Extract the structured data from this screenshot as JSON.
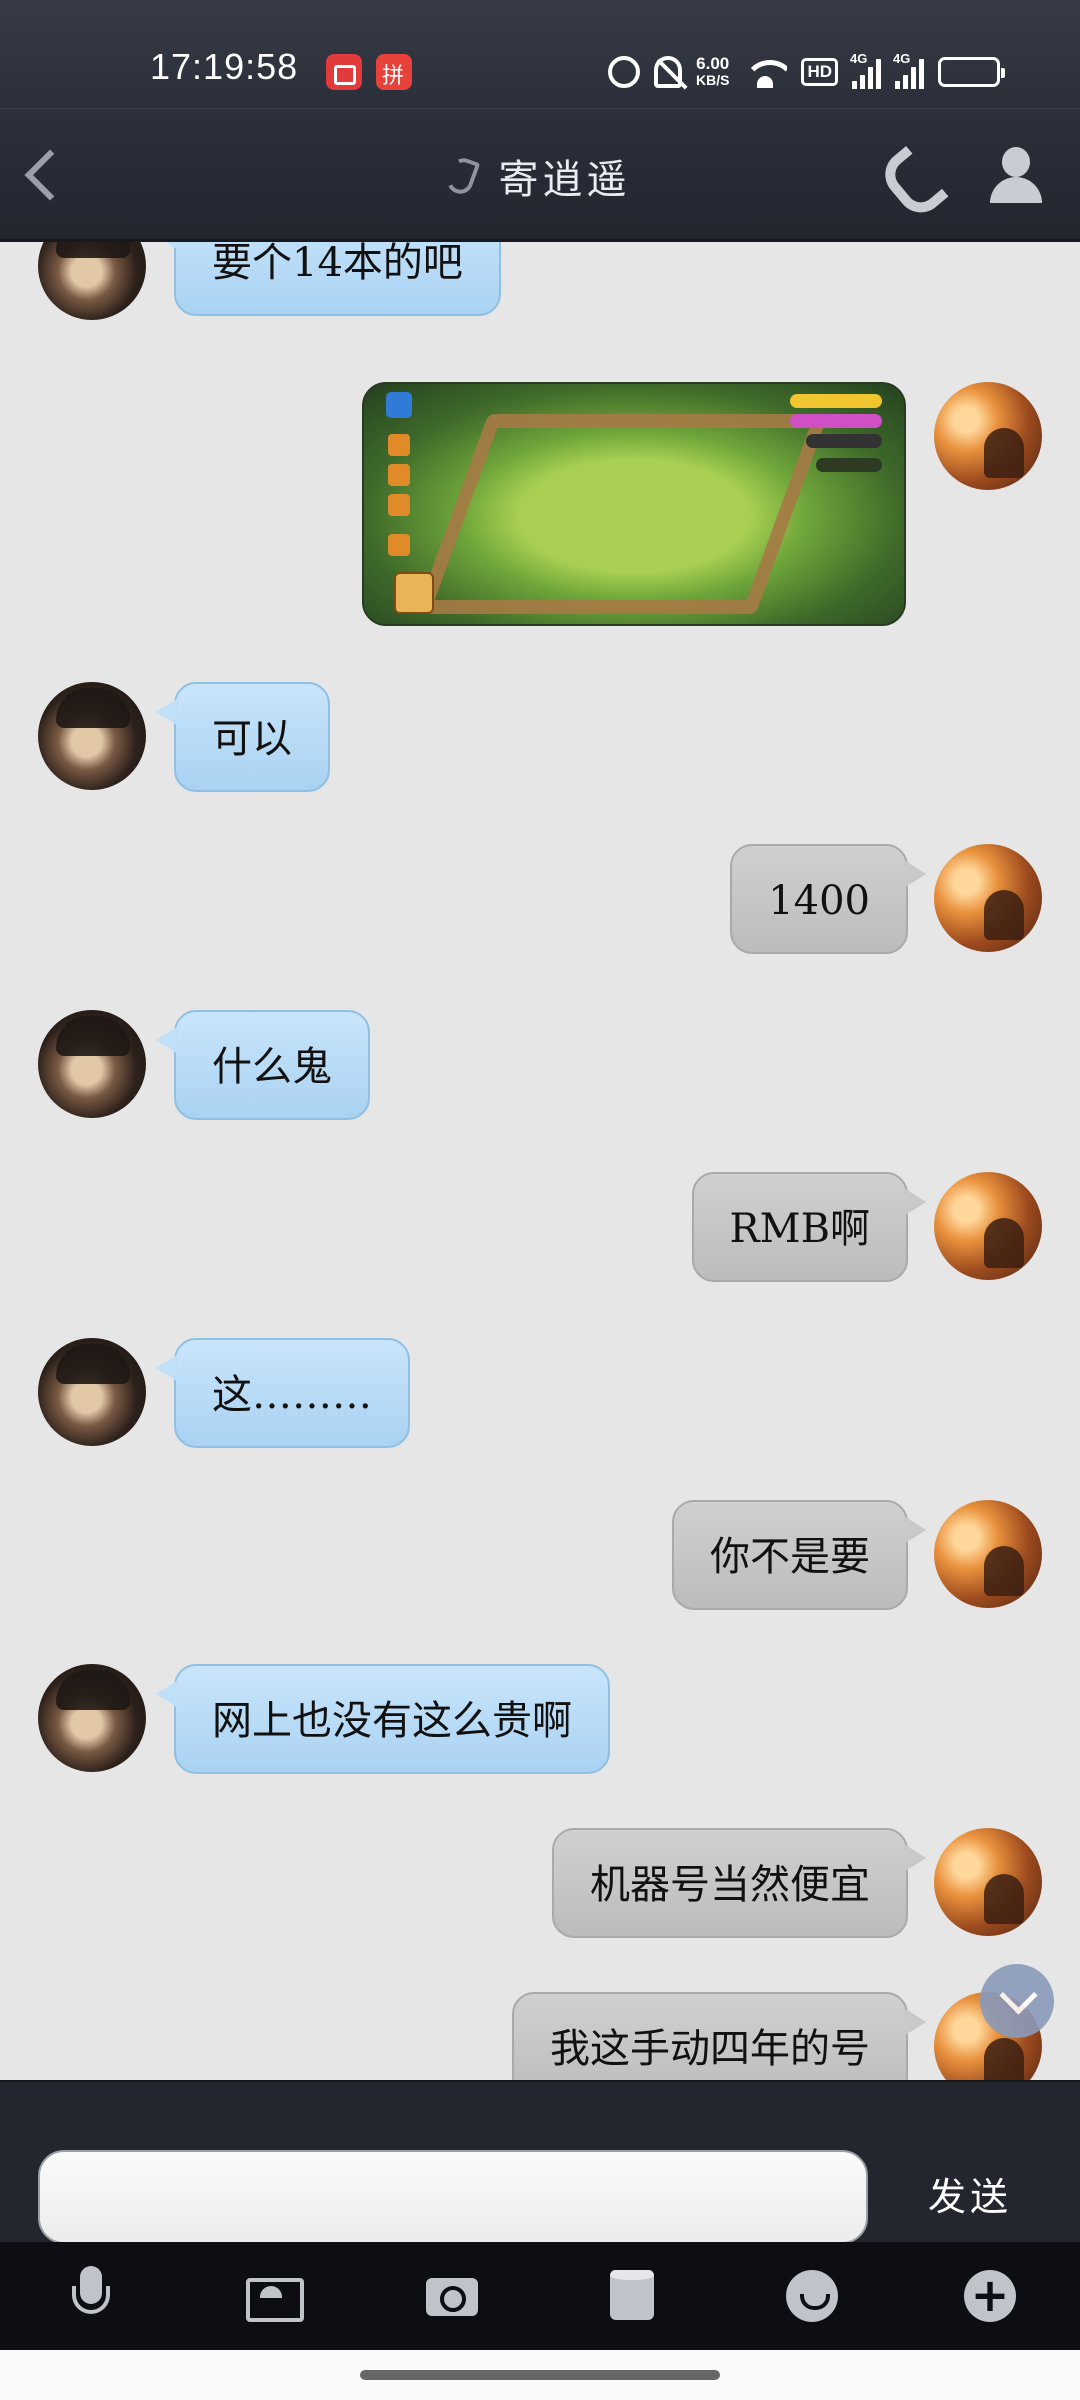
{
  "status_bar": {
    "time": "17:19:58",
    "net_speed": "6.00",
    "net_speed_unit": "KB/S",
    "hd_label": "HD",
    "sim1_label": "4G",
    "sim2_label": "4G"
  },
  "header": {
    "title": "寄逍遥"
  },
  "messages": [
    {
      "side": "in",
      "text": "要个14本的吧"
    },
    {
      "side": "out",
      "type": "image",
      "icon": "game-screenshot"
    },
    {
      "side": "in",
      "text": "可以"
    },
    {
      "side": "out",
      "text": "1400"
    },
    {
      "side": "in",
      "text": "什么鬼"
    },
    {
      "side": "out",
      "text": "RMB啊"
    },
    {
      "side": "in",
      "text": "这………"
    },
    {
      "side": "out",
      "text": "你不是要"
    },
    {
      "side": "in",
      "text": "网上也没有这么贵啊"
    },
    {
      "side": "out",
      "text": "机器号当然便宜"
    },
    {
      "side": "out",
      "text": "我这手动四年的号"
    }
  ],
  "input_bar": {
    "value": "",
    "send_label": "发送"
  },
  "toolbar": {
    "icons": [
      "microphone-icon",
      "gallery-icon",
      "camera-icon",
      "folder-icon",
      "emoji-icon",
      "plus-icon"
    ]
  },
  "colors": {
    "incoming_bubble": "#b7dbf6",
    "outgoing_bubble": "#c6c6c6",
    "header_bg": "#282c36",
    "chat_bg": "#e6e6e6"
  }
}
